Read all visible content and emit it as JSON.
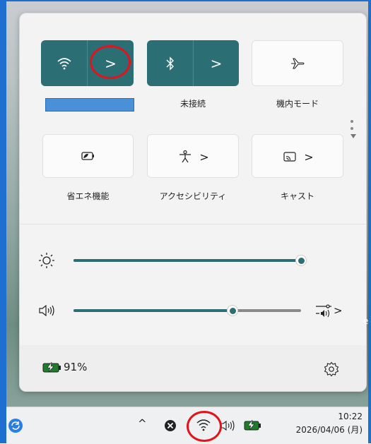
{
  "quick_settings": {
    "tiles_row1": [
      {
        "id": "wifi",
        "label": "",
        "active": true,
        "icon": "wifi-icon",
        "has_chevron": true
      },
      {
        "id": "bluetooth",
        "label": "未接続",
        "active": true,
        "icon": "bluetooth-icon",
        "has_chevron": true
      },
      {
        "id": "airplane",
        "label": "機内モード",
        "active": false,
        "icon": "airplane-icon",
        "has_chevron": false
      }
    ],
    "tiles_row2": [
      {
        "id": "battery_saver",
        "label": "省エネ機能",
        "active": false,
        "icon": "battery-saver-icon",
        "has_chevron": false
      },
      {
        "id": "accessibility",
        "label": "アクセシビリティ",
        "active": false,
        "icon": "accessibility-icon",
        "has_chevron": true
      },
      {
        "id": "cast",
        "label": "キャスト",
        "active": false,
        "icon": "cast-icon",
        "has_chevron": true
      }
    ],
    "chevron": ">",
    "brightness": {
      "icon": "sun-icon",
      "level": 1.0
    },
    "volume": {
      "icon": "speaker-icon",
      "level": 0.7,
      "output_icon": "audio-output-icon",
      "chevron": ">"
    },
    "battery": {
      "icon": "battery-charging-icon",
      "percent": "91%"
    },
    "settings_icon": "gear-icon",
    "wifi_network_name_box_color": "#4a90d9",
    "accent_color": "#2b6e73"
  },
  "taskbar": {
    "left_app_icon": "refresh-app-icon",
    "tray": {
      "chevron_up": "^",
      "icons": [
        "close-circle-icon",
        "wifi-icon",
        "speaker-icon",
        "battery-charging-icon"
      ]
    },
    "time": "10:22",
    "date": "2026/04/06 (月)"
  },
  "highlights": [
    "wifi-chevron-button",
    "taskbar-wifi-icon"
  ]
}
